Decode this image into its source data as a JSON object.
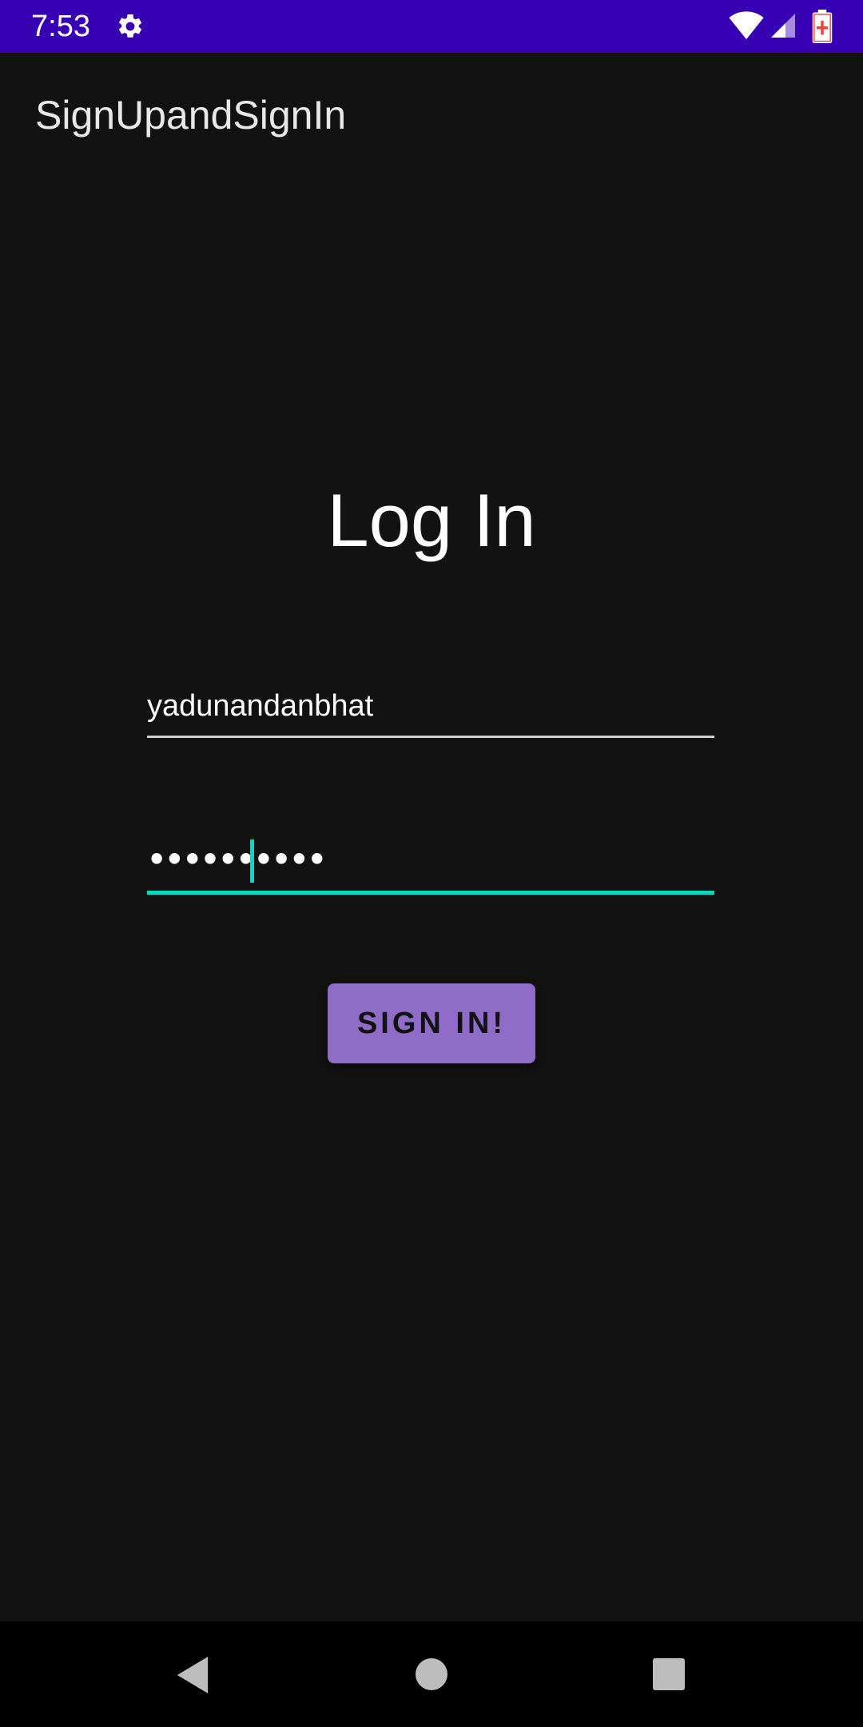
{
  "status_bar": {
    "time": "7:53",
    "icons": [
      "gear-icon",
      "wifi-icon",
      "signal-icon",
      "battery-charging-icon"
    ],
    "background_color": "#3700b3"
  },
  "app_bar": {
    "title": "SignUpandSignIn"
  },
  "login": {
    "title": "Log In",
    "username_value": "yadunandanbhat",
    "password_value": "••••••••••",
    "signin_label": "SIGN IN!",
    "accent_color": "#03dac5",
    "button_color": "#8f6cc8"
  },
  "nav_bar": {
    "icons": [
      "back-icon",
      "home-icon",
      "recents-icon"
    ]
  }
}
